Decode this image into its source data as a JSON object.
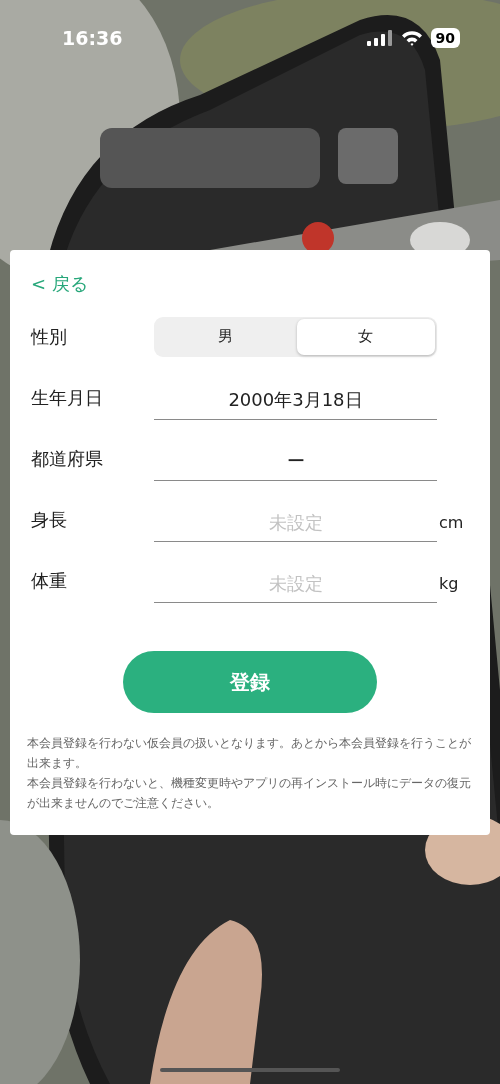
{
  "status_bar": {
    "time": "16:36",
    "battery": "90"
  },
  "form": {
    "back_link": "< 戻る",
    "gender": {
      "label": "性別",
      "options": [
        {
          "label": "男",
          "selected": false
        },
        {
          "label": "女",
          "selected": true
        }
      ]
    },
    "fields": [
      {
        "label": "生年月日",
        "value": "2000年3月18日"
      },
      {
        "label": "都道府県",
        "value": "ー"
      },
      {
        "label": "身長",
        "placeholder": "未設定",
        "unit": "cm"
      },
      {
        "label": "体重",
        "placeholder": "未設定",
        "unit": "kg"
      }
    ],
    "submit_button": "登録",
    "notes": [
      "本会員登録を行わない仮会員の扱いとなります。あとから本会員登録を行うことが出来ます。",
      "本会員登録を行わないと、機種変更時やアプリの再インストール時にデータの復元が出来ませんのでご注意ください。"
    ]
  }
}
